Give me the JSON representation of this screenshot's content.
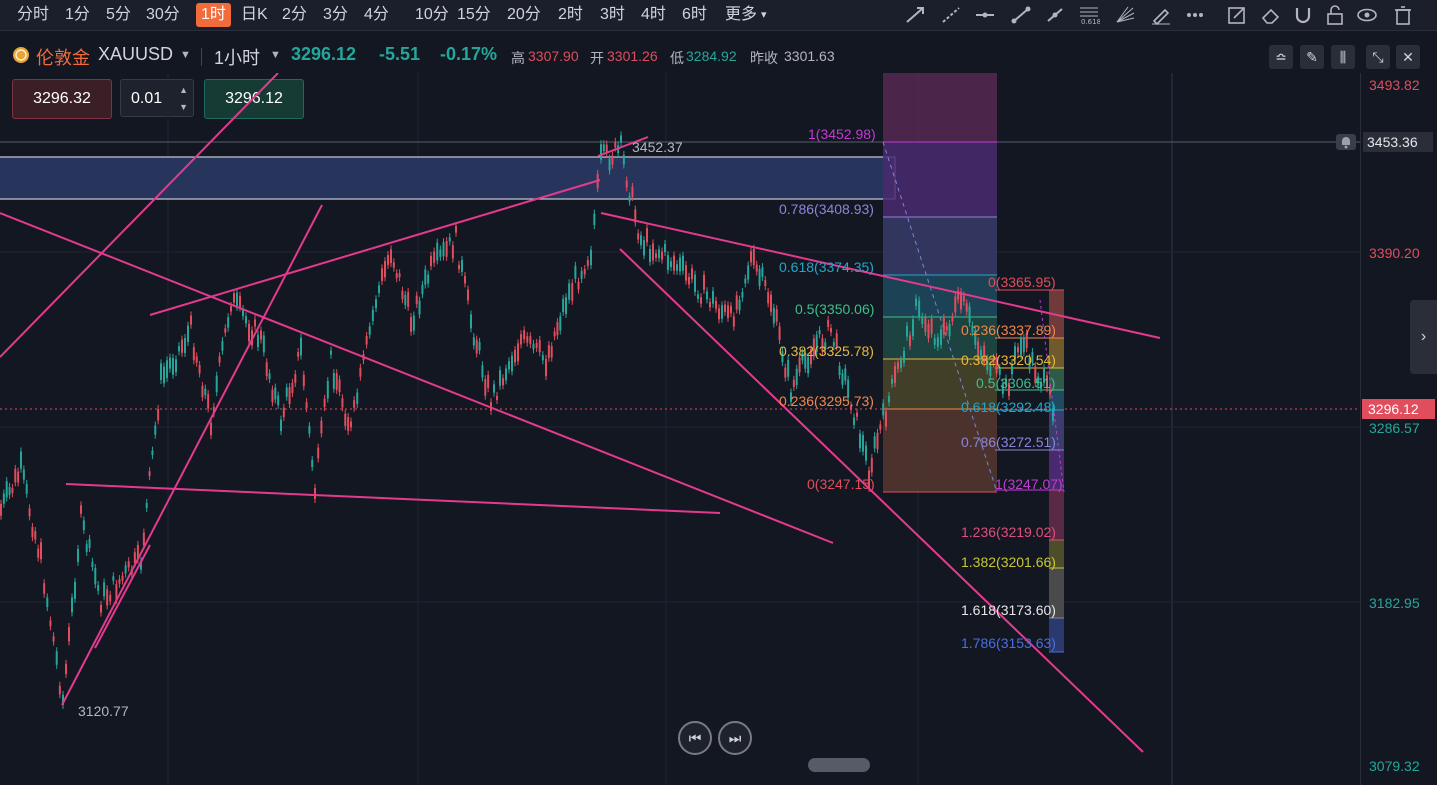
{
  "toolbar": {
    "timeframes": [
      "分时",
      "1分",
      "5分",
      "30分",
      "1时",
      "日K",
      "2分",
      "3分",
      "4分",
      "10分",
      "15分",
      "20分",
      "2时",
      "3时",
      "4时",
      "6时",
      "更多"
    ],
    "active": "1时",
    "more_caret": "▾"
  },
  "symbol": {
    "name": "伦敦金",
    "code": "XAUUSD",
    "interval": "1小时",
    "last": "3296.12",
    "change": "-5.51",
    "change_pct": "-0.17%",
    "high_label": "高",
    "high": "3307.90",
    "open_label": "开",
    "open": "3301.26",
    "low_label": "低",
    "low": "3284.92",
    "prev_label": "昨收",
    "prev": "3301.63"
  },
  "trade": {
    "bid": "3296.32",
    "qty": "0.01",
    "ask": "3296.12"
  },
  "price_axis": {
    "labels": [
      "3493.82",
      "3453.36",
      "3390.20",
      "3296.12",
      "3286.57",
      "3182.95",
      "3079.32"
    ]
  },
  "annotations": {
    "high_marker": "3452.37",
    "low_marker": "3120.77"
  },
  "fib_left": [
    {
      "label": "1(3452.98)",
      "color": "#c13bd3"
    },
    {
      "label": "0.786(3408.93)",
      "color": "#8c85d8"
    },
    {
      "label": "0.618(3374.35)",
      "color": "#22a6c9"
    },
    {
      "label": "0.5(3350.06)",
      "color": "#3fbf8a"
    },
    {
      "label": "0.382(3325.78)",
      "color": "#e6b93a"
    },
    {
      "label": "0.236(3295.73)",
      "color": "#f0884a"
    },
    {
      "label": "0(3247.15)",
      "color": "#e04d5c"
    }
  ],
  "fib_right": [
    {
      "label": "0(3365.95)",
      "color": "#e04d5c"
    },
    {
      "label": "0.236(3337.89)",
      "color": "#f0884a"
    },
    {
      "label": "0.382(3320.54)",
      "color": "#e6b93a"
    },
    {
      "label": "0.5(3306.51)",
      "color": "#3fbf8a"
    },
    {
      "label": "0.618(3292.48)",
      "color": "#22a6c9"
    },
    {
      "label": "0.786(3272.51)",
      "color": "#8c85d8"
    },
    {
      "label": "1(3247.07)",
      "color": "#c13bd3"
    },
    {
      "label": "1.236(3219.02)",
      "color": "#e04d7a"
    },
    {
      "label": "1.382(3201.66)",
      "color": "#c8c832"
    },
    {
      "label": "1.618(3173.60)",
      "color": "#e6e6e6"
    },
    {
      "label": "1.786(3153.63)",
      "color": "#4c6ee0"
    }
  ],
  "nav": {
    "prev_icon": "⏮",
    "next_icon": "⏭"
  },
  "colors": {
    "up": "#26a69a",
    "down": "#e04d5c",
    "trend": "#e43a8e"
  }
}
